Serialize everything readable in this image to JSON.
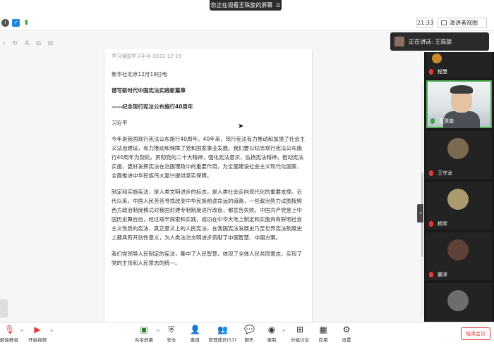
{
  "share_banner": {
    "text": "您正在观看王珠旋的屏幕",
    "menu_icon": "menu-icon"
  },
  "status": {
    "time": "21:33",
    "view_label": "演讲者视图"
  },
  "doc": {
    "source": "学习强国学习平台 2022-12-19",
    "dateline": "新华社北京12月19日电",
    "title": "谱写新时代中国宪法实践新篇章",
    "subtitle": "——纪念现行宪法公布施行40周年",
    "author": "习近平",
    "para1": "今年是我国现行宪法公布施行40周年。40年来，现行宪法有力推动和加强了社会主义法治建设，有力推动和保障了党和国家事业发展。我们要以纪念现行宪法公布施行40周年为契机，贯彻党的二十大精神，强化宪法意识，弘扬宪法精神，推动宪法实施，更好发挥宪法在治国理政中的重要作用，为全面建设社会主义现代化国家、全面推进中华民族伟大复兴提供坚实保障。",
    "para2": "制定和实施宪法，是人类文明进步的标志，是人类社会走向现代化的重要支撑。近代以来，中国人民苦苦寻找改变中华民族前途命运的道路，一些政治势力试图按照西方政治制度模式对我国封建专制制度进行改良，都宣告失败。中国共产党登上中国历史舞台后，经过艰辛探索和实践，成功在中华大地上制定和实施具有鲜明社会主义性质的宪法、真正意义上的人民宪法，在我国宪法发展史乃至世界宪法制度史上都具有开创性意义，为人类法治文明进步贡献了中国智慧、中国方案。",
    "para3": "我们党领导人民制定的宪法，集中了人民智慧，体现了全体人民共同意志，实现了党的主张和人民意志的统一。"
  },
  "speaking": {
    "label": "正在讲话: 王珠旋"
  },
  "participants": [
    {
      "name": "程慧",
      "mic": "muted"
    },
    {
      "name": "王珠旋",
      "mic": "on",
      "video": true
    },
    {
      "name": "王守龙",
      "mic": "muted"
    },
    {
      "name": "杨琴",
      "mic": "muted"
    },
    {
      "name": "霸凉",
      "mic": "muted"
    },
    {
      "name": "",
      "mic": "muted"
    }
  ],
  "toolbar": {
    "mute": "解除静音",
    "video": "开启视频",
    "share": "共享屏幕",
    "security": "安全",
    "invite": "邀请",
    "members": "管理成员(57)",
    "chat": "聊天",
    "record": "录制",
    "breakout": "分组讨论",
    "apps": "应用",
    "settings": "设置",
    "end": "结束会议"
  }
}
